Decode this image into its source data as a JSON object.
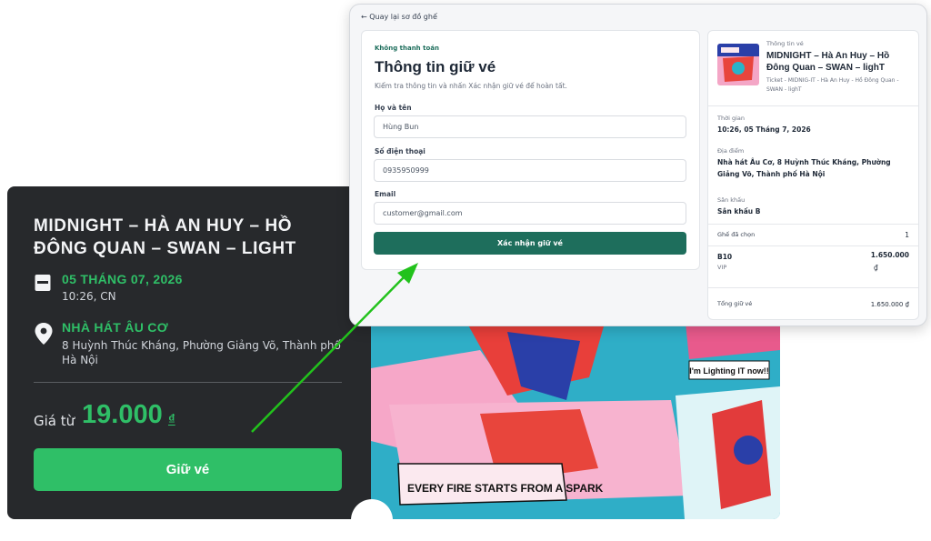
{
  "event": {
    "title": "MIDNIGHT – HÀ AN HUY – HỒ ĐÔNG QUAN – SWAN – LIGHT",
    "date": "05 THÁNG 07, 2026",
    "time": "10:26, CN",
    "venue": "NHÀ HÁT ÂU CƠ",
    "address": "8 Huỳnh Thúc Kháng, Phường Giảng Võ, Thành phố Hà Nội",
    "price_label": "Giá từ",
    "price_value": "19.000",
    "price_currency": "₫",
    "hold_button": "Giữ vé"
  },
  "poster": {
    "banner": "EVERY FIRE STARTS FROM A SPARK",
    "speech": "I'm Lighting IT now!!"
  },
  "popup": {
    "back_link": "← Quay lại sơ đồ ghế",
    "form": {
      "eyebrow": "Không thanh toán",
      "title": "Thông tin giữ vé",
      "description": "Kiểm tra thông tin và nhấn Xác nhận giữ vé để hoàn tất.",
      "name_label": "Họ và tên",
      "name_value": "Hùng Bun",
      "phone_label": "Số điện thoại",
      "phone_value": "0935950999",
      "email_label": "Email",
      "email_value": "customer@gmail.com",
      "confirm_button": "Xác nhận giữ vé"
    },
    "summary": {
      "eyebrow": "Thông tin vé",
      "title": "MIDNIGHT – Hà An Huy – Hồ Đông Quan – SWAN – lighT",
      "subtitle": "Ticket - MIDNIG-IT - Hà An Huy - Hồ Đông Quan - SWAN - lighT",
      "time_label": "Thời gian",
      "time_value": "10:26, 05 Tháng 7, 2026",
      "place_label": "Địa điểm",
      "place_value": "Nhà hát Âu Cơ, 8 Huỳnh Thúc Kháng, Phường Giảng Võ, Thành phố Hà Nội",
      "stage_label": "Sân khấu",
      "stage_value": "Sân khấu B",
      "seats_label": "Ghế đã chọn",
      "seats_count": "1",
      "seat_code": "B10",
      "seat_type": "VIP",
      "seat_price": "1.650.000",
      "seat_currency": "₫",
      "total_label": "Tổng giữ vé",
      "total_value": "1.650.000 ₫"
    }
  },
  "colors": {
    "brand_green": "#2fbf67",
    "confirm_teal": "#1e6e5c",
    "card_dark": "#27292c",
    "arrow_green": "#22c21c"
  }
}
